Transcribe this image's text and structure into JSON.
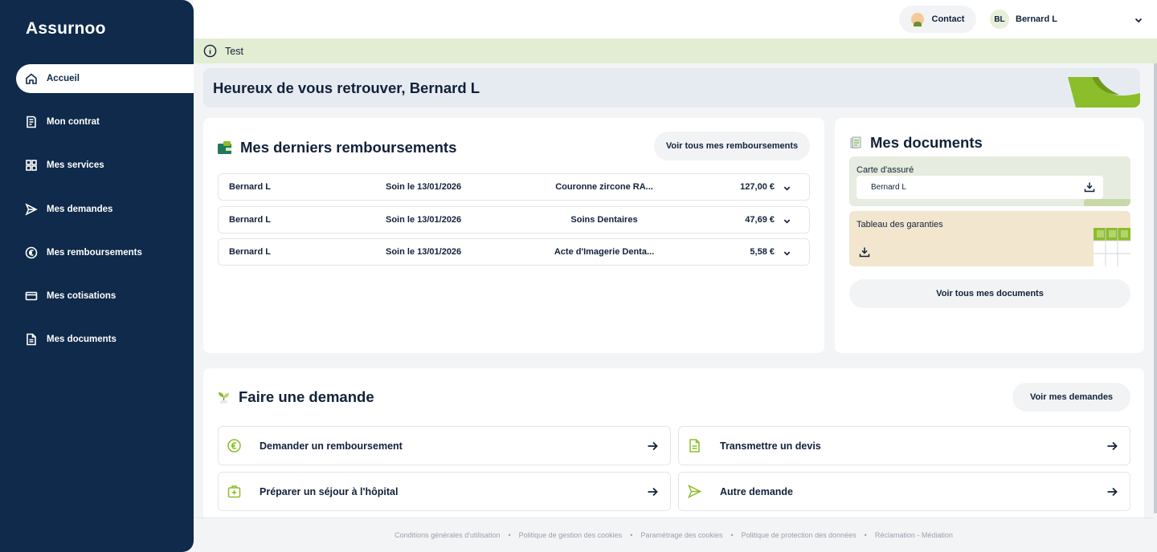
{
  "brand": {
    "logo": "Assurnoo"
  },
  "sidebar": {
    "items": [
      {
        "label": "Accueil",
        "icon": "home-icon",
        "active": true
      },
      {
        "label": "Mon contrat",
        "icon": "contract-icon",
        "active": false
      },
      {
        "label": "Mes services",
        "icon": "grid-icon",
        "active": false
      },
      {
        "label": "Mes demandes",
        "icon": "send-icon",
        "active": false
      },
      {
        "label": "Mes remboursements",
        "icon": "euro-icon",
        "active": false
      },
      {
        "label": "Mes cotisations",
        "icon": "card-icon",
        "active": false
      },
      {
        "label": "Mes documents",
        "icon": "document-icon",
        "active": false
      }
    ]
  },
  "topbar": {
    "contact_label": "Contact",
    "user_initials": "BL",
    "user_name": "Bernard L"
  },
  "info_banner": {
    "text": "Test"
  },
  "welcome": {
    "text": "Heureux de vous retrouver, Bernard L"
  },
  "reimbursements": {
    "title": "Mes derniers remboursements",
    "see_all_label": "Voir tous mes remboursements",
    "rows": [
      {
        "name": "Bernard L",
        "date": "Soin le 13/01/2026",
        "act": "Couronne zircone RA...",
        "amount": "127,00 €"
      },
      {
        "name": "Bernard L",
        "date": "Soin le 13/01/2026",
        "act": "Soins Dentaires",
        "amount": "47,69 €"
      },
      {
        "name": "Bernard L",
        "date": "Soin le 13/01/2026",
        "act": "Acte d'Imagerie Denta...",
        "amount": "5,58 €"
      }
    ]
  },
  "documents": {
    "title": "Mes documents",
    "insured_card_label": "Carte d'assuré",
    "insured_card_holder": "Bernard L",
    "guarantees_label": "Tableau des garanties",
    "see_all_label": "Voir tous mes documents"
  },
  "requests": {
    "title": "Faire une demande",
    "see_all_label": "Voir mes demandes",
    "items": [
      {
        "label": "Demander un remboursement",
        "icon": "euro-icon"
      },
      {
        "label": "Transmettre un devis",
        "icon": "document-icon"
      },
      {
        "label": "Préparer un séjour à l'hôpital",
        "icon": "hospital-icon"
      },
      {
        "label": "Autre demande",
        "icon": "send-icon"
      }
    ]
  },
  "footer": {
    "links": [
      "Conditions générales d'utilisation",
      "Politique de gestion des cookies",
      "Paramétrage des cookies",
      "Politique de protection des données",
      "Réclamation - Médiation"
    ],
    "separator": "•"
  },
  "colors": {
    "sidebar": "#0f2a4a",
    "accent_green": "#8cbd2a",
    "banner_green": "#e2edd3",
    "welcome_bg": "#e6ebf1",
    "doc_card_green": "#e6ecdf",
    "doc_table_beige": "#f2e6cf"
  }
}
